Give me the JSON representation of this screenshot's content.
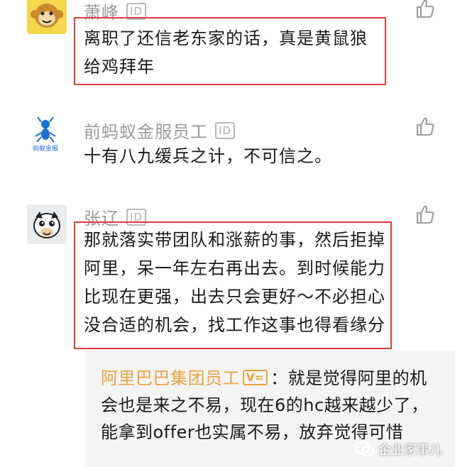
{
  "comments": [
    {
      "username": "萧峰",
      "badge": "ID",
      "avatar_icon": "monkey-avatar-icon",
      "text": "离职了还信老东家的话，真是黄鼠狼给鸡拜年",
      "highlighted": true
    },
    {
      "username": "前蚂蚁金服员工",
      "badge": "ID",
      "avatar_icon": "ant-financial-logo-icon",
      "avatar_caption": "蚂蚁金服",
      "text": "十有八九缓兵之计，不可信之。",
      "highlighted": false
    },
    {
      "username": "张辽",
      "badge": "ID",
      "avatar_icon": "cartoon-cow-avatar-icon",
      "text": "那就落实带团队和涨薪的事，然后拒掉阿里，呆一年左右再出去。到时候能力比现在更强，出去只会更好～不必担心没合适的机会，找工作这事也得看缘分",
      "highlighted": true,
      "reply": {
        "author": "阿里巴巴集团员工",
        "badge": "V=",
        "separator": "：",
        "text": "就是觉得阿里的机会也是来之不易，现在6的hc越来越少了，能拿到offer也实属不易，放弃觉得可惜"
      }
    }
  ],
  "watermark": {
    "text": "企业家事儿",
    "icon": "wechat-icon"
  },
  "colors": {
    "highlight_border": "#e03a3a",
    "reply_author": "#e9a240",
    "username": "#9a9a9a"
  }
}
